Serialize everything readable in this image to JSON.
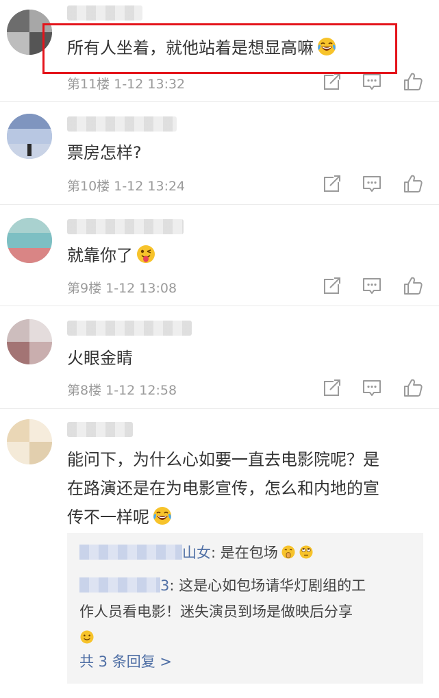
{
  "comments": [
    {
      "text": "所有人坐着，就他站着是想显高嘛",
      "floor": "第11楼",
      "time": "1-12 13:32",
      "emoji": "laugh-cry-emoji"
    },
    {
      "text": "票房怎样?",
      "floor": "第10楼",
      "time": "1-12 13:24"
    },
    {
      "text": "就靠你了",
      "floor": "第9楼",
      "time": "1-12 13:08",
      "emoji": "tongue-wink-emoji"
    },
    {
      "text": "火眼金睛",
      "floor": "第8楼",
      "time": "1-12 12:58"
    },
    {
      "text_line1": "能问下，为什么心如要一直去电影院呢？是",
      "text_line2": "在路演还是在为电影宣传，怎么和内地的宣",
      "text_line3": "传不一样呢",
      "emoji": "laugh-cry-emoji",
      "replies": [
        {
          "name_suffix": "山女",
          "text": ": 是在包场",
          "emojis": [
            "shush-emoji",
            "eye-roll-emoji"
          ]
        },
        {
          "name_suffix": "3",
          "text_line1": ": 这是心如包场请华灯剧组的工",
          "text_line2": "作人员看电影！迷失演员到场是做映后分享",
          "emoji": "smile-emoji"
        }
      ],
      "more_replies": "共 3 条回复 >"
    }
  ],
  "icons": {
    "share": "share-icon",
    "comment": "comment-icon",
    "like": "thumbs-up-icon"
  },
  "colors": {
    "highlight": "#e4141b",
    "meta": "#9a9a9a",
    "link": "#4f6fa5",
    "reply_bg": "#f4f4f4"
  }
}
